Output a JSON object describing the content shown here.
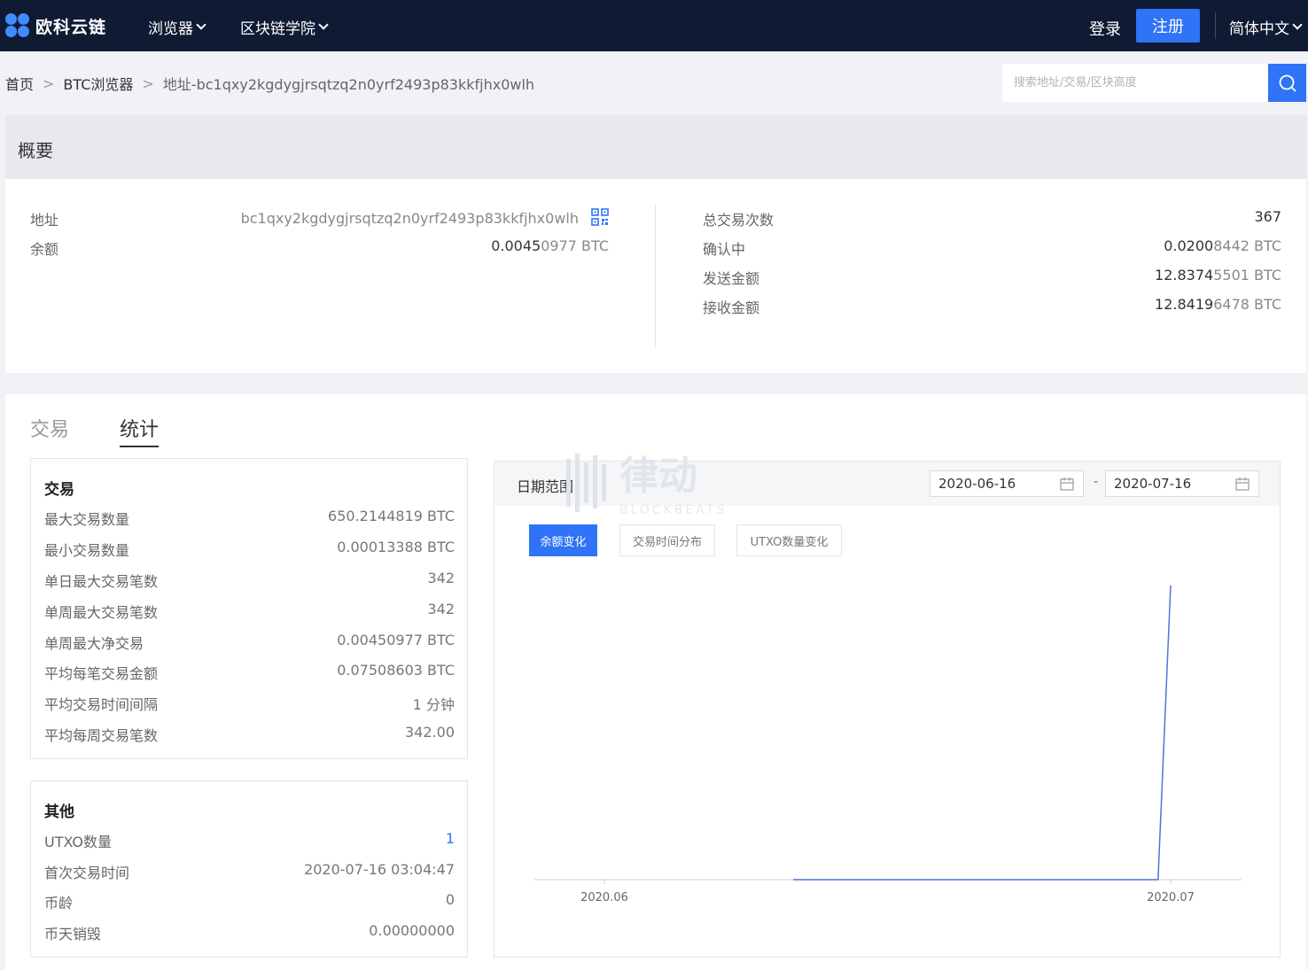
{
  "nav": {
    "logo": "欧科云链",
    "menu": [
      {
        "label": "浏览器"
      },
      {
        "label": "区块链学院"
      }
    ],
    "login": "登录",
    "register": "注册",
    "language": "简体中文"
  },
  "breadcrumb": {
    "home": "首页",
    "explorer": "BTC浏览器",
    "current": "地址-bc1qxy2kgdygjrsqtzq2n0yrf2493p83kkfjhx0wlh"
  },
  "search": {
    "placeholder": "搜索地址/交易/区块高度"
  },
  "overview": {
    "title": "概要",
    "address_label": "地址",
    "address": "bc1qxy2kgdygjrsqtzq2n0yrf2493p83kkfjhx0wlh",
    "balance_label": "余额",
    "balance_main": "0.0045",
    "balance_rest": "0977 BTC",
    "total_tx_label": "总交易次数",
    "total_tx": "367",
    "confirming_label": "确认中",
    "confirming_main": "0.0200",
    "confirming_rest": "8442 BTC",
    "sent_label": "发送金额",
    "sent_main": "12.8374",
    "sent_rest": "5501 BTC",
    "received_label": "接收金额",
    "received_main": "12.8419",
    "received_rest": "6478 BTC"
  },
  "tabs": {
    "trade": "交易",
    "stats": "统计"
  },
  "trade_card": {
    "title": "交易",
    "rows": [
      {
        "label": "最大交易数量",
        "value": "650.2144819 BTC"
      },
      {
        "label": "最小交易数量",
        "value": "0.00013388 BTC"
      },
      {
        "label": "单日最大交易笔数",
        "value": "342"
      },
      {
        "label": "单周最大交易笔数",
        "value": "342"
      },
      {
        "label": "单周最大净交易",
        "value": "0.00450977 BTC"
      },
      {
        "label": "平均每笔交易金额",
        "value": "0.07508603 BTC"
      },
      {
        "label": "平均交易时间间隔",
        "value": "1 分钟"
      },
      {
        "label": "平均每周交易笔数",
        "value": "342.00"
      }
    ]
  },
  "other_card": {
    "title": "其他",
    "rows": [
      {
        "label": "UTXO数量",
        "value": "1"
      },
      {
        "label": "首次交易时间",
        "value": "2020-07-16 03:04:47"
      },
      {
        "label": "币龄",
        "value": "0"
      },
      {
        "label": "币天销毁",
        "value": "0.00000000"
      }
    ]
  },
  "chart_panel": {
    "range_label": "日期范围",
    "date_from": "2020-06-16",
    "date_to": "2020-07-16",
    "date_sep": "-",
    "buttons": [
      {
        "label": "余额变化",
        "active": true
      },
      {
        "label": "交易时间分布",
        "active": false
      },
      {
        "label": "UTXO数量变化",
        "active": false
      }
    ]
  },
  "watermark": {
    "main": "律动",
    "sub": "BLOCKBEATS"
  },
  "chart_data": {
    "type": "line",
    "title": "",
    "xlabel": "",
    "ylabel": "",
    "x_ticks": [
      "2020.06",
      "2020.07"
    ],
    "series": [
      {
        "x": [
          "2020-06-16",
          "2020-07-15",
          "2020-07-16"
        ],
        "values": [
          0,
          0,
          0.00450977
        ]
      }
    ],
    "line_color": "#4a77d4",
    "grid": false
  }
}
